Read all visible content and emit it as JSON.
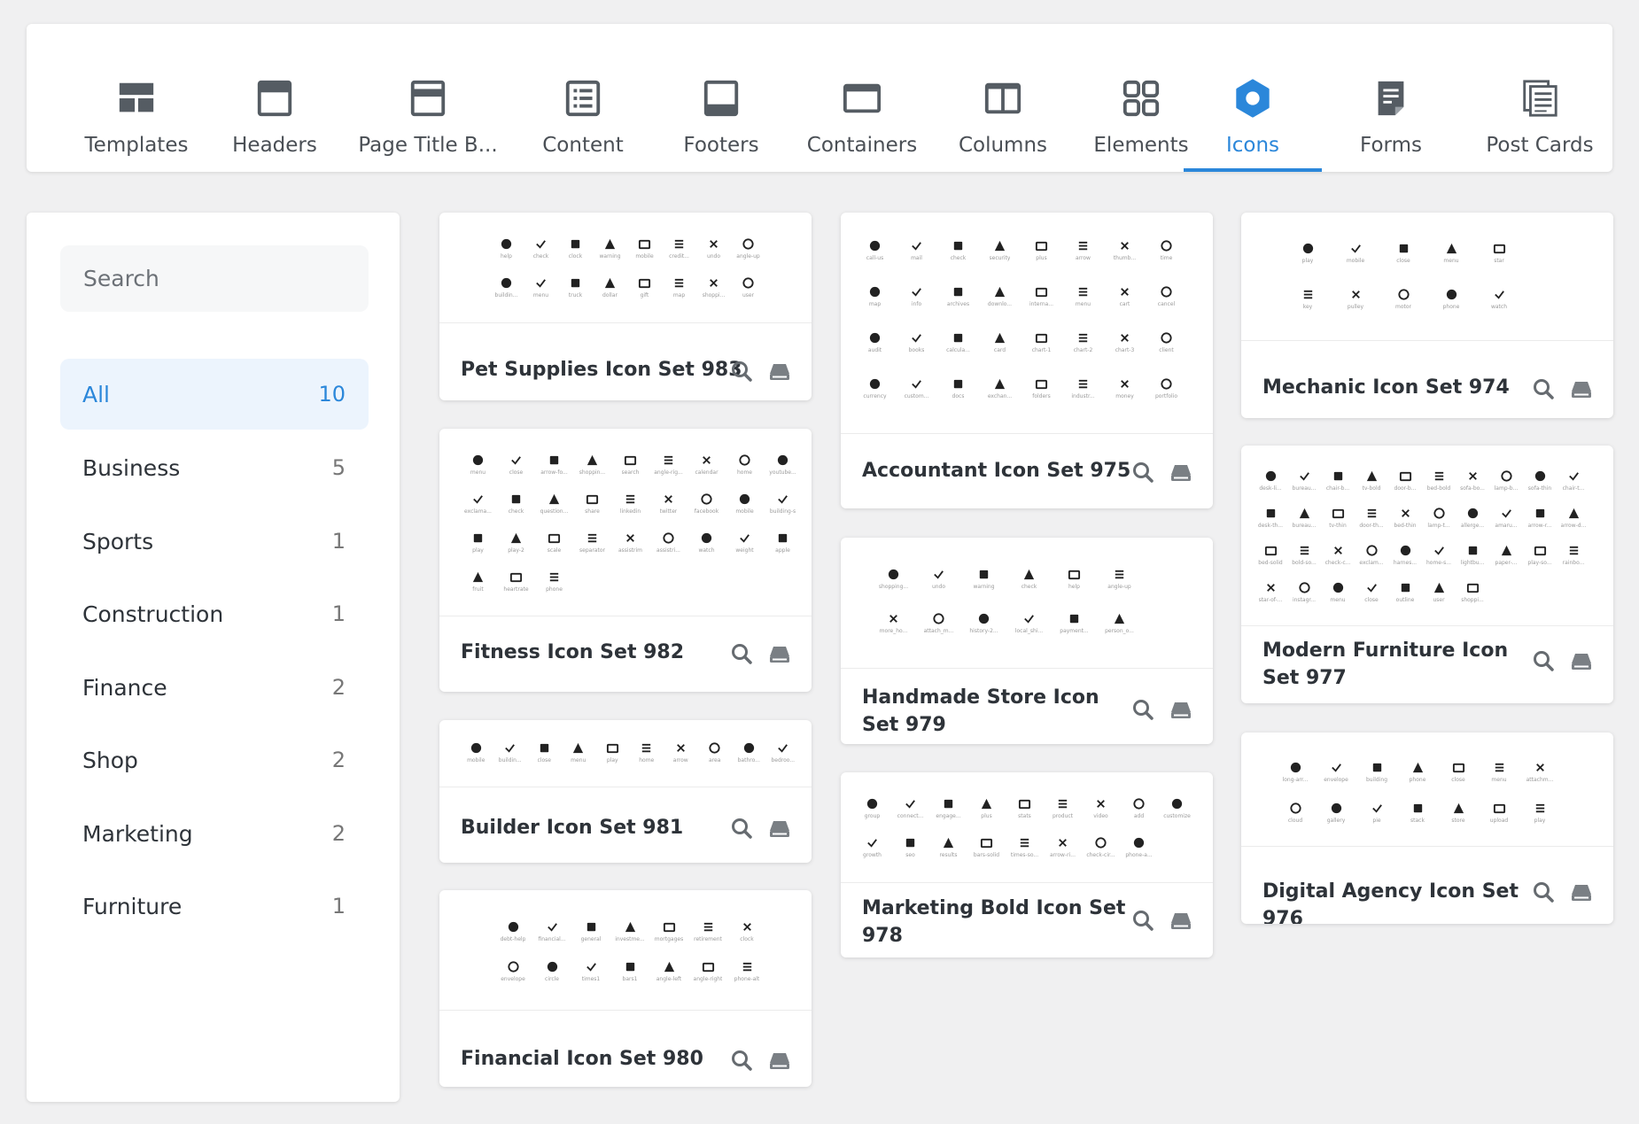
{
  "tabs": [
    {
      "label": "Templates",
      "icon": "templates-icon"
    },
    {
      "label": "Headers",
      "icon": "headers-icon"
    },
    {
      "label": "Page Title B...",
      "icon": "page-title-icon"
    },
    {
      "label": "Content",
      "icon": "content-icon"
    },
    {
      "label": "Footers",
      "icon": "footers-icon"
    },
    {
      "label": "Containers",
      "icon": "containers-icon"
    },
    {
      "label": "Columns",
      "icon": "columns-icon"
    },
    {
      "label": "Elements",
      "icon": "elements-icon"
    },
    {
      "label": "Icons",
      "icon": "icons-icon",
      "active": true
    },
    {
      "label": "Forms",
      "icon": "forms-icon"
    },
    {
      "label": "Post Cards",
      "icon": "post-cards-icon"
    }
  ],
  "sidebar": {
    "search_placeholder": "Search",
    "categories": [
      {
        "name": "All",
        "count": "10",
        "active": true
      },
      {
        "name": "Business",
        "count": "5"
      },
      {
        "name": "Sports",
        "count": "1"
      },
      {
        "name": "Construction",
        "count": "1"
      },
      {
        "name": "Finance",
        "count": "2"
      },
      {
        "name": "Shop",
        "count": "2"
      },
      {
        "name": "Marketing",
        "count": "2"
      },
      {
        "name": "Furniture",
        "count": "1"
      }
    ]
  },
  "cards": {
    "pet": {
      "title": "Pet Supplies Icon Set 983",
      "icons": [
        "help",
        "check",
        "clock",
        "warning",
        "mobile",
        "credit...",
        "undo",
        "angle-up",
        "buildin...",
        "menu",
        "truck",
        "dollar",
        "gift",
        "map",
        "shoppi...",
        "user"
      ]
    },
    "fitness": {
      "title": "Fitness Icon Set 982",
      "icons": [
        "menu",
        "close",
        "arrow-fo...",
        "shoppin...",
        "search",
        "angle-rig...",
        "calendar",
        "home",
        "youtube...",
        "exclama...",
        "check",
        "question...",
        "share",
        "linkedin",
        "twitter",
        "facebook",
        "mobile",
        "building-s",
        "play",
        "play-2",
        "scale",
        "separator",
        "assistrim",
        "assistri...",
        "watch",
        "weight",
        "apple",
        "fruit",
        "heartrate",
        "phone"
      ]
    },
    "builder": {
      "title": "Builder Icon Set 981",
      "icons": [
        "mobile",
        "buildin...",
        "close",
        "menu",
        "play",
        "home",
        "arrow",
        "area",
        "bathro...",
        "bedroo..."
      ]
    },
    "financial": {
      "title": "Financial Icon Set 980",
      "icons": [
        "debt-help",
        "financial...",
        "general",
        "investme...",
        "mortgages",
        "retirement",
        "clock",
        "envelope",
        "circle",
        "times1",
        "bars1",
        "angle-left",
        "angle-right",
        "phone-alt"
      ]
    },
    "accountant": {
      "title": "Accountant Icon Set 975",
      "icons": [
        "call-us",
        "mail",
        "check",
        "security",
        "plus",
        "arrow",
        "thumb...",
        "time",
        "map",
        "info",
        "archives",
        "downlo...",
        "interna...",
        "menu",
        "cart",
        "cancel",
        "audit",
        "books",
        "calcula...",
        "card",
        "chart-1",
        "chart-2",
        "chart-3",
        "client",
        "currency",
        "custom...",
        "docs",
        "exchan...",
        "folders",
        "industr...",
        "money",
        "portfolio"
      ]
    },
    "handmade": {
      "title": "Handmade Store Icon Set 979",
      "icons": [
        "shopping...",
        "undo",
        "warning",
        "check",
        "help",
        "angle-up",
        "more_ho...",
        "attach_m...",
        "history-2...",
        "local_shi...",
        "payment...",
        "person_o..."
      ]
    },
    "marketing": {
      "title": "Marketing Bold Icon Set 978",
      "icons": [
        "group",
        "connect...",
        "engage...",
        "plus",
        "stats",
        "product",
        "video",
        "add",
        "customize",
        "growth",
        "seo",
        "results",
        "bars-solid",
        "times-so...",
        "arrow-ri...",
        "check-cir...",
        "phone-a..."
      ]
    },
    "mechanic": {
      "title": "Mechanic Icon Set 974",
      "icons": [
        "play",
        "mobile",
        "close",
        "menu",
        "star",
        "key",
        "pulley",
        "motor",
        "phone",
        "watch"
      ]
    },
    "furniture": {
      "title": "Modern Furniture Icon Set 977",
      "icons": [
        "desk-li...",
        "bureau...",
        "chair-b...",
        "tv-bold",
        "door-b...",
        "bed-bold",
        "sofa-bo...",
        "lamp-b...",
        "sofa-thin",
        "chair-t...",
        "desk-th...",
        "bureau...",
        "tv-thin",
        "door-th...",
        "bed-thin",
        "lamp-t...",
        "allerge...",
        "amaru...",
        "arrow-r...",
        "arrow-d...",
        "bed-solid",
        "bold-so...",
        "check-c...",
        "exclam...",
        "harnes...",
        "home-s...",
        "lightbu...",
        "paper-...",
        "play-so...",
        "rainbo...",
        "star-of-...",
        "instagr...",
        "menu",
        "close",
        "outline",
        "user",
        "shoppi..."
      ]
    },
    "digital": {
      "title": "Digital Agency Icon Set 976",
      "icons": [
        "long-arr...",
        "envelope",
        "building",
        "phone",
        "close",
        "menu",
        "attachm...",
        "cloud",
        "gallery",
        "pie",
        "stack",
        "store",
        "upload",
        "play"
      ]
    }
  },
  "colors": {
    "accent": "#2b87da",
    "text": "#2e3339",
    "background": "#f0f0f1"
  }
}
